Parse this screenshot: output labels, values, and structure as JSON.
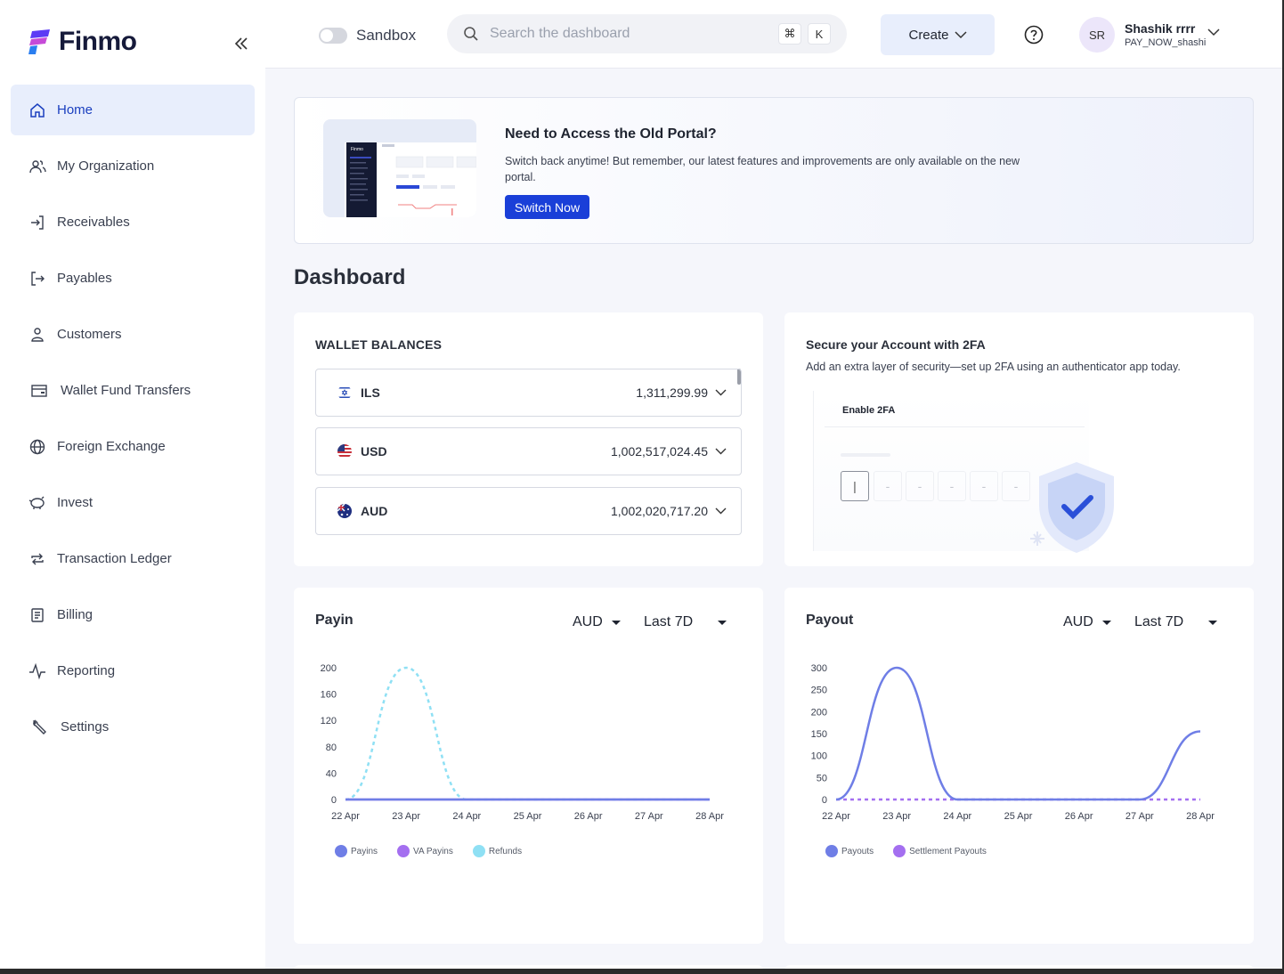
{
  "app": {
    "name": "Finmo"
  },
  "sidebar": {
    "items": [
      {
        "label": "Home",
        "icon": "home-icon",
        "active": true
      },
      {
        "label": "My Organization",
        "icon": "users-icon"
      },
      {
        "label": "Receivables",
        "icon": "sign-in-icon"
      },
      {
        "label": "Payables",
        "icon": "sign-out-icon"
      },
      {
        "label": "Customers",
        "icon": "user-icon"
      },
      {
        "label": "Wallet Fund Transfers",
        "icon": "wallet-icon"
      },
      {
        "label": "Foreign Exchange",
        "icon": "globe-icon"
      },
      {
        "label": "Invest",
        "icon": "piggy-bank-icon"
      },
      {
        "label": "Transaction Ledger",
        "icon": "repeat-icon"
      },
      {
        "label": "Billing",
        "icon": "receipt-icon"
      },
      {
        "label": "Reporting",
        "icon": "activity-icon"
      },
      {
        "label": "Settings",
        "icon": "wrench-icon"
      }
    ]
  },
  "topbar": {
    "sandbox_label": "Sandbox",
    "search_placeholder": "Search the dashboard",
    "shortcut_cmd": "⌘",
    "shortcut_key": "K",
    "create_label": "Create",
    "avatar_initials": "SR",
    "user_name": "Shashik rrrr",
    "user_handle": "PAY_NOW_shashi"
  },
  "banner": {
    "title": "Need to Access the Old Portal?",
    "text": "Switch back anytime! But remember, our latest features and improvements are only available on the new portal.",
    "button": "Switch Now",
    "thumb_logo": "Finmo"
  },
  "dashboard": {
    "title": "Dashboard"
  },
  "wallet": {
    "heading": "WALLET BALANCES",
    "rows": [
      {
        "currency": "ILS",
        "amount": "1,311,299.99"
      },
      {
        "currency": "USD",
        "amount": "1,002,517,024.45"
      },
      {
        "currency": "AUD",
        "amount": "1,002,020,717.20"
      }
    ]
  },
  "twofa": {
    "title": "Secure your Account with 2FA",
    "text": "Add an extra layer of security—set up 2FA using an authenticator app today.",
    "enable_label": "Enable 2FA",
    "slot_char": "-"
  },
  "payin": {
    "title": "Payin",
    "currency": "AUD",
    "period": "Last 7D",
    "legend": [
      "Payins",
      "VA Payins",
      "Refunds"
    ]
  },
  "payout": {
    "title": "Payout",
    "currency": "AUD",
    "period": "Last 7D",
    "legend": [
      "Payouts",
      "Settlement Payouts"
    ]
  },
  "colors": {
    "accent": "#1a3fd8",
    "payins": "#6f7ee6",
    "va_payins": "#a46ff0",
    "refunds": "#8fe0f4",
    "active_bg": "#e8eefc"
  },
  "chart_data": [
    {
      "type": "line",
      "title": "Payin",
      "x": [
        "22 Apr",
        "23 Apr",
        "24 Apr",
        "25 Apr",
        "26 Apr",
        "27 Apr",
        "28 Apr"
      ],
      "yticks": [
        0,
        40,
        80,
        120,
        160,
        200
      ],
      "ylim": [
        0,
        200
      ],
      "series": [
        {
          "name": "Payins",
          "values": [
            0,
            0,
            0,
            0,
            0,
            0,
            0
          ],
          "style": "solid"
        },
        {
          "name": "VA Payins",
          "values": [
            0,
            0,
            0,
            0,
            0,
            0,
            0
          ],
          "style": "solid"
        },
        {
          "name": "Refunds",
          "values": [
            0,
            200,
            0,
            0,
            0,
            0,
            0
          ],
          "style": "dashed"
        }
      ],
      "legend_position": "bottom-left"
    },
    {
      "type": "line",
      "title": "Payout",
      "x": [
        "22 Apr",
        "23 Apr",
        "24 Apr",
        "25 Apr",
        "26 Apr",
        "27 Apr",
        "28 Apr"
      ],
      "yticks": [
        0,
        50,
        100,
        150,
        200,
        250,
        300
      ],
      "ylim": [
        0,
        300
      ],
      "series": [
        {
          "name": "Payouts",
          "values": [
            0,
            300,
            0,
            0,
            0,
            0,
            155
          ],
          "style": "solid"
        },
        {
          "name": "Settlement Payouts",
          "values": [
            0,
            0,
            0,
            0,
            0,
            0,
            0
          ],
          "style": "dashed"
        }
      ],
      "legend_position": "bottom-left"
    }
  ]
}
